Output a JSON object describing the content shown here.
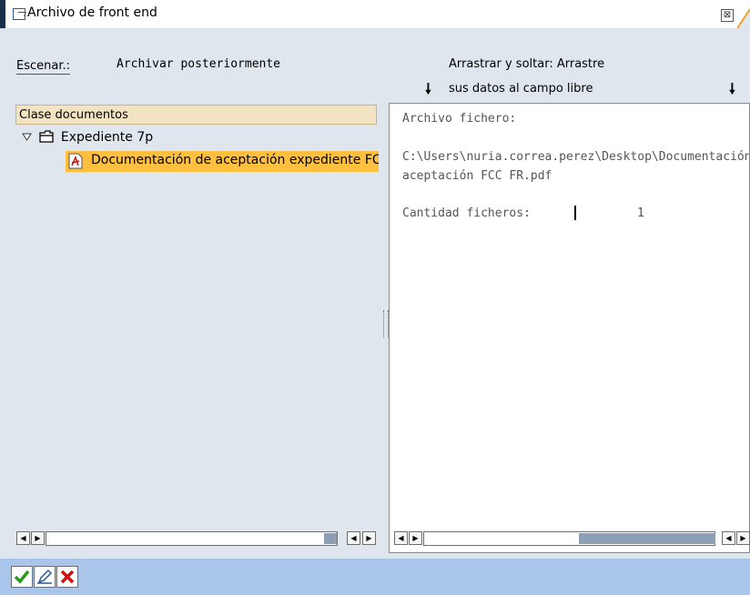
{
  "window": {
    "title": "Archivo de front end",
    "close_glyph": "⊠"
  },
  "header": {
    "scenario_label": "Escenar.:",
    "scenario_value": "Archivar posteriormente",
    "drag_line1": "Arrastrar y soltar: Arrastre",
    "drag_line2": "sus datos al campo libre"
  },
  "tree": {
    "header": "Clase documentos",
    "folder_label": "Expediente 7p",
    "document_label": "Documentación de aceptación expediente FCC FR.pdf"
  },
  "info": {
    "file_label": "Archivo fichero:",
    "file_path_line1": "C:\\Users\\nuria.correa.perez\\Desktop\\Documentación de",
    "file_path_line2": "aceptación FCC FR.pdf",
    "count_label": "Cantidad ficheros:",
    "count_value": "1"
  },
  "icons": [
    "window-icon",
    "close-icon",
    "arrow-down-icon",
    "collapse-triangle-icon",
    "folder-icon",
    "pdf-icon",
    "scroll-left-icon",
    "scroll-right-icon",
    "check-icon",
    "edit-icon",
    "cancel-icon"
  ],
  "colors": {
    "selection": "#ffbf3f",
    "header_bg": "#f2e4c2",
    "panel_bg": "#dfe6ee",
    "toolbar_bg": "#a9c6ea"
  }
}
